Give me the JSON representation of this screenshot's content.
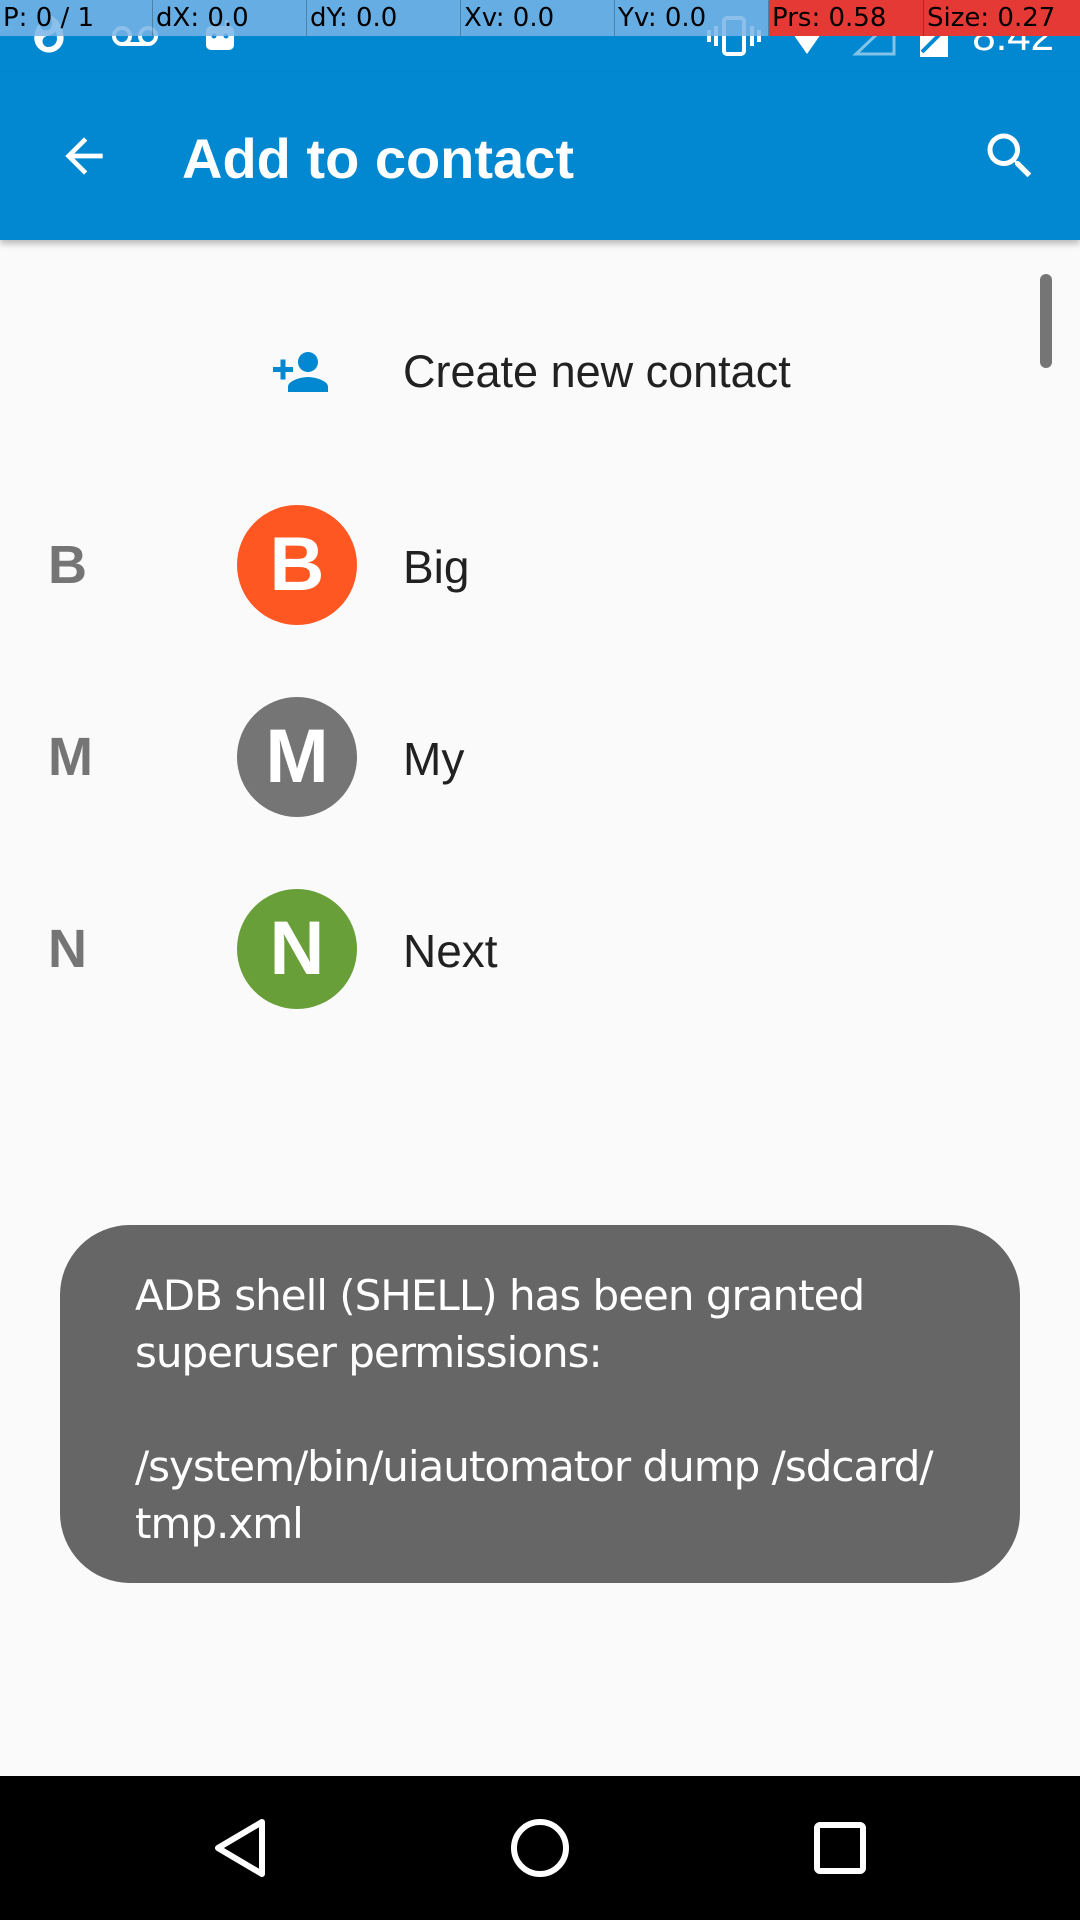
{
  "pointer_overlay": [
    {
      "text": "P: 0 / 1",
      "highlight": false
    },
    {
      "text": "dX: 0.0",
      "highlight": false
    },
    {
      "text": "dY: 0.0",
      "highlight": false
    },
    {
      "text": "Xv: 0.0",
      "highlight": false
    },
    {
      "text": "Yv: 0.0",
      "highlight": false
    },
    {
      "text": "Prs: 0.58",
      "highlight": true
    },
    {
      "text": "Size: 0.27",
      "highlight": true
    }
  ],
  "status_bar": {
    "time": "8:42",
    "left_icons": [
      "fire-icon",
      "voicemail-icon",
      "android-icon"
    ],
    "right_icons": [
      "vibrate-icon",
      "wifi-icon",
      "signal-icon",
      "battery-icon"
    ]
  },
  "app_bar": {
    "title": "Add to contact",
    "back_icon": "arrow-back-icon",
    "search_icon": "search-icon"
  },
  "create_new": {
    "label": "Create new contact",
    "icon": "person-add-icon",
    "color": "#0288d1"
  },
  "contacts": [
    {
      "section": "B",
      "initial": "B",
      "name": "Big",
      "color": "#ff5722"
    },
    {
      "section": "M",
      "initial": "M",
      "name": "My",
      "color": "#757575"
    },
    {
      "section": "N",
      "initial": "N",
      "name": "Next",
      "color": "#689f38"
    }
  ],
  "toast": {
    "line1": "ADB shell (SHELL) has been granted",
    "line2": "superuser permissions:",
    "line3": "/system/bin/uiautomator dump /sdcard/",
    "line4": "tmp.xml"
  },
  "nav_bar": {
    "back": "nav-back-icon",
    "home": "nav-home-icon",
    "recents": "nav-recents-icon"
  },
  "colors": {
    "primary": "#0288d1",
    "background": "#fafafa",
    "toast_bg": "#666666"
  }
}
